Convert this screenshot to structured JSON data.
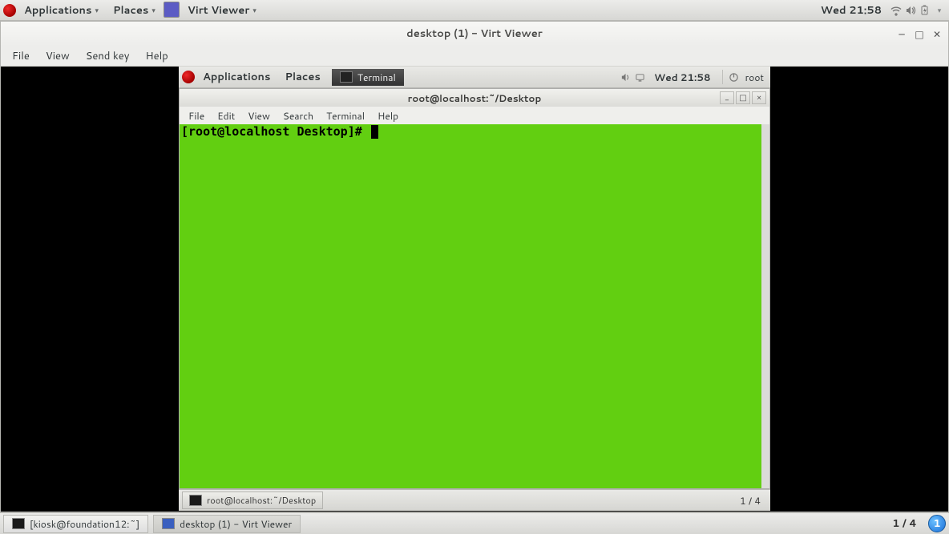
{
  "host_panel": {
    "applications": "Applications",
    "places": "Places",
    "active_app": "Virt Viewer",
    "clock": "Wed 21:58"
  },
  "virt_viewer": {
    "title": "desktop (1) - Virt Viewer",
    "menu": {
      "file": "File",
      "view": "View",
      "sendkey": "Send key",
      "help": "Help"
    }
  },
  "guest_panel": {
    "applications": "Applications",
    "places": "Places",
    "task": "Terminal",
    "clock": "Wed 21:58",
    "user": "root"
  },
  "terminal": {
    "title": "root@localhost:~/Desktop",
    "menu": {
      "file": "File",
      "edit": "Edit",
      "view": "View",
      "search": "Search",
      "terminal": "Terminal",
      "help": "Help"
    },
    "prompt": "[root@localhost Desktop]# "
  },
  "guest_bottom": {
    "task": "root@localhost:~/Desktop",
    "pager": "1 / 4"
  },
  "host_bottom": {
    "task1": "[kiosk@foundation12:~]",
    "task2": "desktop (1) - Virt Viewer",
    "pager": "1 / 4",
    "updates": "1"
  }
}
